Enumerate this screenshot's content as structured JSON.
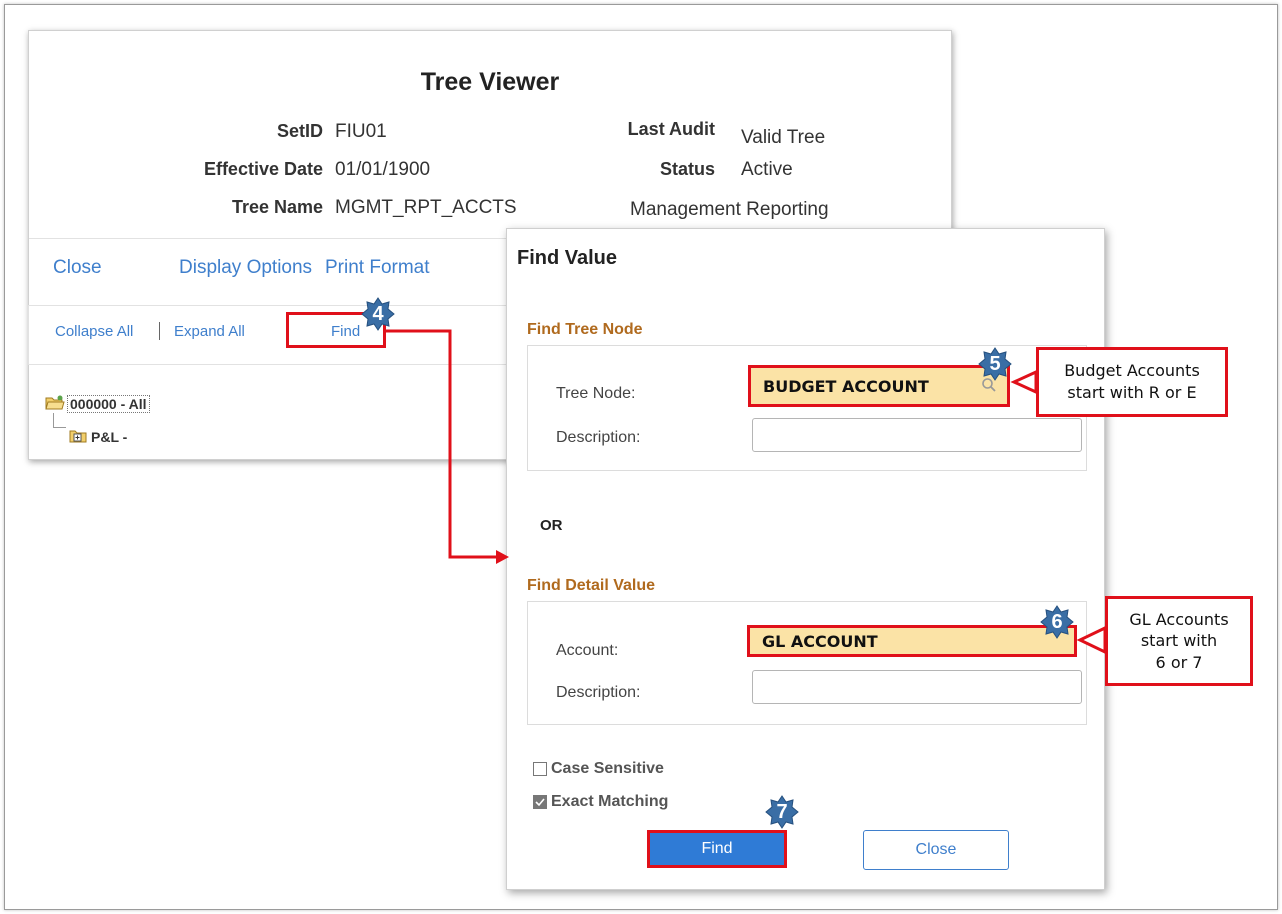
{
  "tree_viewer": {
    "title": "Tree Viewer",
    "setid_label": "SetID",
    "setid_value": "FIU01",
    "effdate_label": "Effective Date",
    "effdate_value": "01/01/1900",
    "treename_label": "Tree Name",
    "treename_value": "MGMT_RPT_ACCTS",
    "lastaudit_label": "Last Audit",
    "lastaudit_value": "Valid Tree",
    "status_label": "Status",
    "status_value": "Active",
    "tree_description": "Management Reporting",
    "links": {
      "close": "Close",
      "display_options": "Display Options",
      "print_format": "Print Format"
    },
    "toolbar": {
      "collapse_all": "Collapse All",
      "expand_all": "Expand All",
      "find": "Find"
    },
    "tree": {
      "root": "000000 - All",
      "child": "P&L -"
    }
  },
  "dialog": {
    "title": "Find Value",
    "find_tree_node": {
      "section": "Find Tree Node",
      "tree_node_label": "Tree Node:",
      "tree_node_value": "BUDGET ACCOUNT",
      "description_label": "Description:",
      "description_value": ""
    },
    "or_label": "OR",
    "find_detail_value": {
      "section": "Find Detail Value",
      "account_label": "Account:",
      "account_value": "GL ACCOUNT",
      "description_label": "Description:",
      "description_value": ""
    },
    "case_sensitive": {
      "label": "Case Sensitive",
      "checked": false
    },
    "exact_matching": {
      "label": "Exact Matching",
      "checked": true
    },
    "find_button": "Find",
    "close_button": "Close"
  },
  "annotations": {
    "step4": "4",
    "step5": "5",
    "step6": "6",
    "step7": "7",
    "callout5": [
      "Budget Accounts",
      "start with R or E"
    ],
    "callout6": [
      "GL Accounts",
      "start with",
      "6 or 7"
    ],
    "accent_color": "#e0101a",
    "badge_color": "#3a6ea5"
  }
}
